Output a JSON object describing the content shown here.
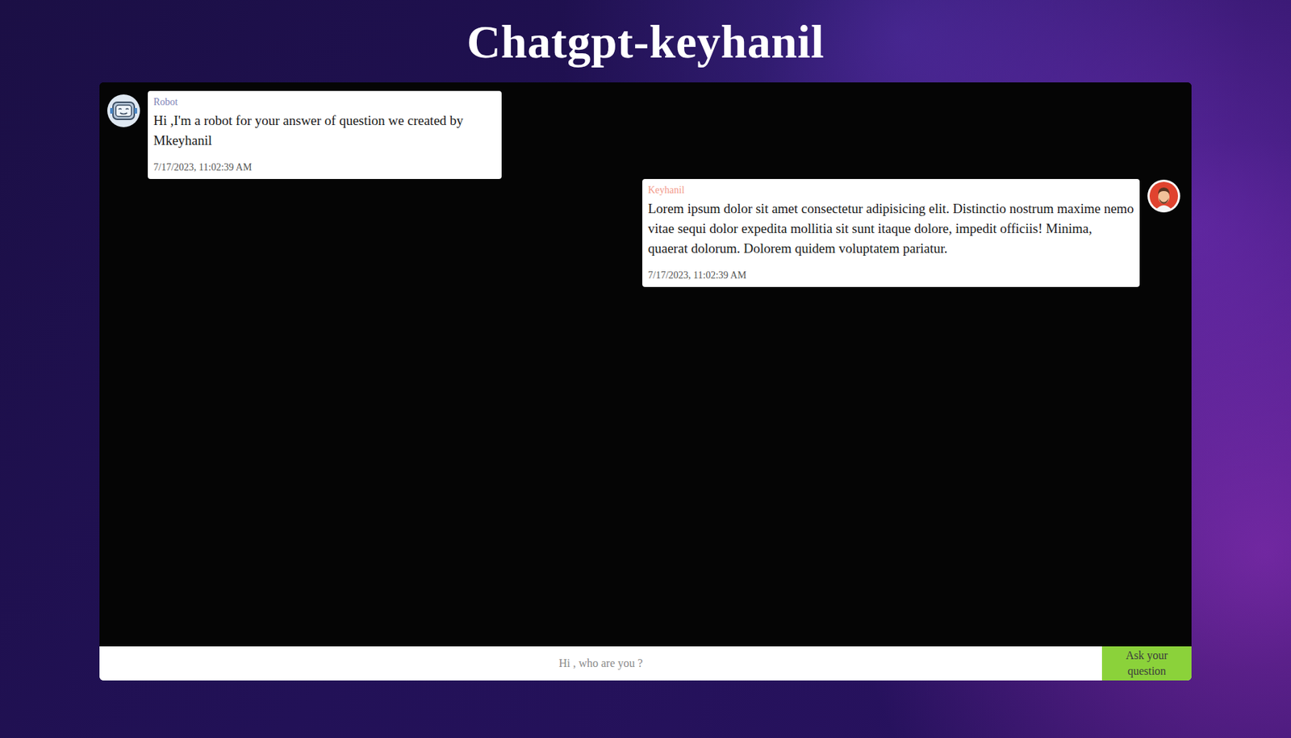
{
  "title": "Chatgpt-keyhanil",
  "messages": [
    {
      "sender": "Robot",
      "kind": "bot",
      "text": "Hi ,I'm a robot for your answer of question we created by Mkeyhanil",
      "time": "7/17/2023, 11:02:39 AM",
      "color": "#7b7fb5"
    },
    {
      "sender": "Keyhanil",
      "kind": "user",
      "text": "Lorem ipsum dolor sit amet consectetur adipisicing elit. Distinctio nostrum maxime nemo vitae sequi dolor expedita mollitia sit sunt itaque dolore, impedit officiis! Minima, quaerat dolorum. Dolorem quidem voluptatem pariatur.",
      "time": "7/17/2023, 11:02:39 AM",
      "color": "#f29a8a"
    }
  ],
  "input": {
    "placeholder": "Hi , who are you ?"
  },
  "button": "Ask your question"
}
